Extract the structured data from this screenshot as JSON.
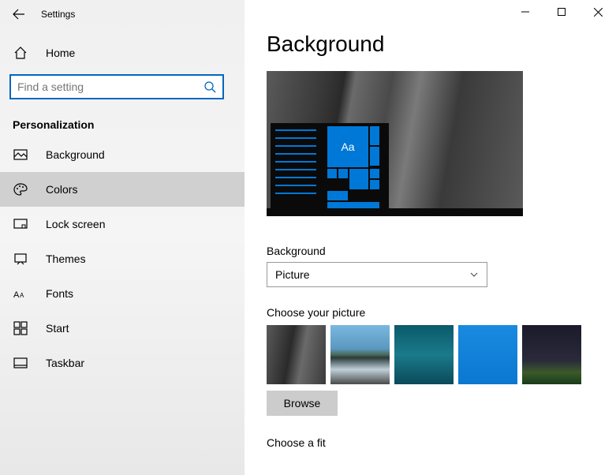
{
  "app": {
    "title": "Settings"
  },
  "sidebar": {
    "home": "Home",
    "search_placeholder": "Find a setting",
    "section": "Personalization",
    "items": [
      {
        "label": "Background"
      },
      {
        "label": "Colors"
      },
      {
        "label": "Lock screen"
      },
      {
        "label": "Themes"
      },
      {
        "label": "Fonts"
      },
      {
        "label": "Start"
      },
      {
        "label": "Taskbar"
      }
    ]
  },
  "main": {
    "title": "Background",
    "preview_tile_text": "Aa",
    "bg_label": "Background",
    "bg_value": "Picture",
    "choose_label": "Choose your picture",
    "browse": "Browse",
    "fit_label": "Choose a fit"
  }
}
